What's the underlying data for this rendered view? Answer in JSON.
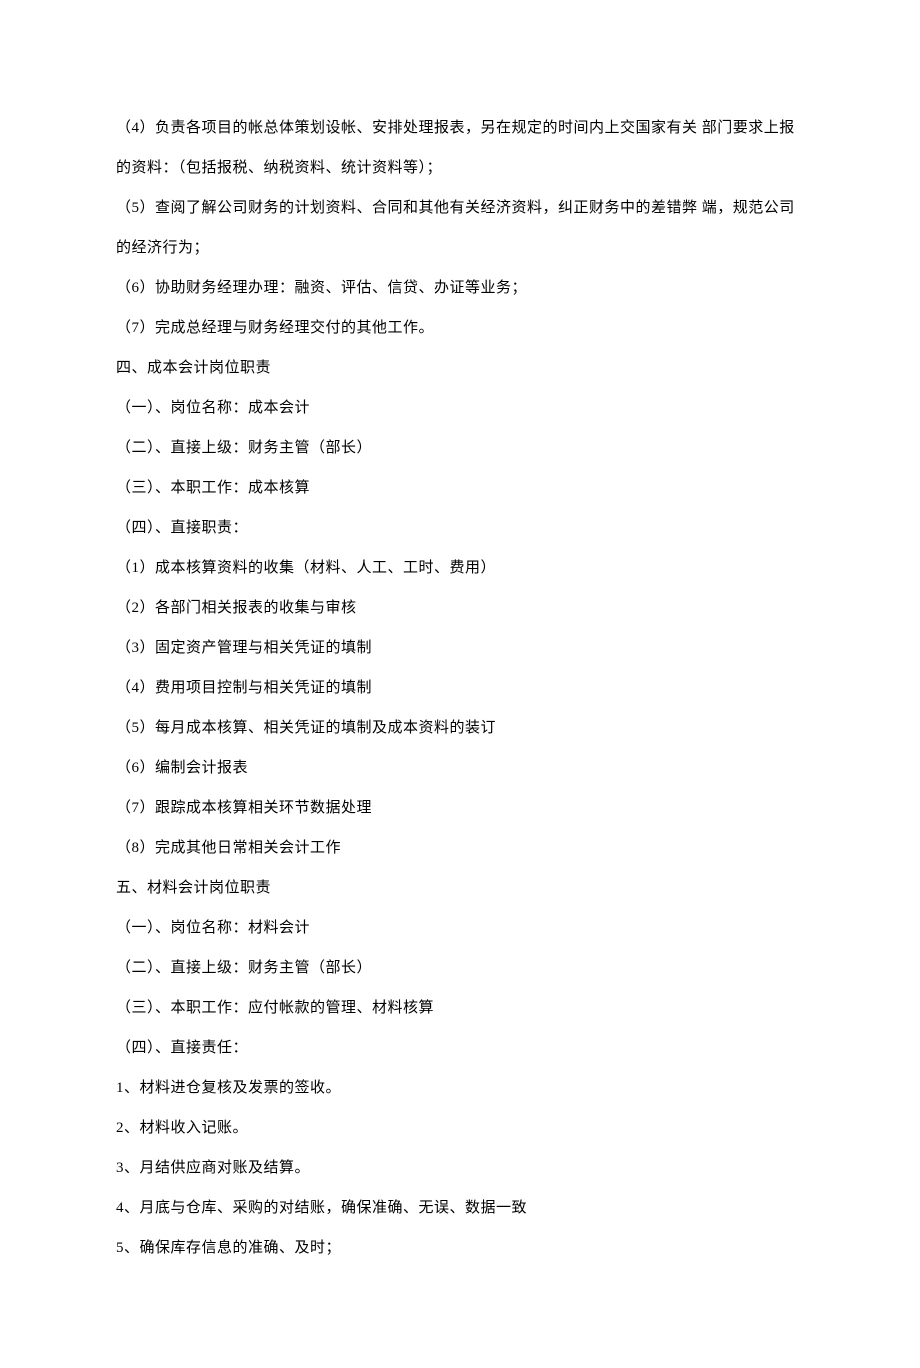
{
  "lines": [
    "（4）负责各项目的帐总体策划设帐、安排处理报表，另在规定的时间内上交国家有关 部门要求上报的资料：（包括报税、纳税资料、统计资料等）；",
    "（5）查阅了解公司财务的计划资料、合同和其他有关经济资料，纠正财务中的差错弊 端，规范公司的经济行为；",
    "（6）协助财务经理办理：融资、评估、信贷、办证等业务；",
    "（7）完成总经理与财务经理交付的其他工作。",
    "四、成本会计岗位职责",
    "（一）、岗位名称：成本会计",
    "（二）、直接上级：财务主管（部长）",
    "（三）、本职工作：成本核算",
    "（四）、直接职责：",
    "（1）成本核算资料的收集（材料、人工、工时、费用）",
    "（2）各部门相关报表的收集与审核",
    "（3）固定资产管理与相关凭证的填制",
    "（4）费用项目控制与相关凭证的填制",
    "（5）每月成本核算、相关凭证的填制及成本资料的装订",
    "（6）编制会计报表",
    "（7）跟踪成本核算相关环节数据处理",
    "（8）完成其他日常相关会计工作",
    "五、材料会计岗位职责",
    "（一）、岗位名称：材料会计",
    "（二）、直接上级：财务主管（部长）",
    "（三）、本职工作：应付帐款的管理、材料核算",
    "（四）、直接责任：",
    "1、材料进仓复核及发票的签收。",
    "2、材料收入记账。",
    "3、月结供应商对账及结算。",
    "4、月底与仓库、采购的对结账，确保准确、无误、数据一致",
    "5、确保库存信息的准确、及时；"
  ]
}
